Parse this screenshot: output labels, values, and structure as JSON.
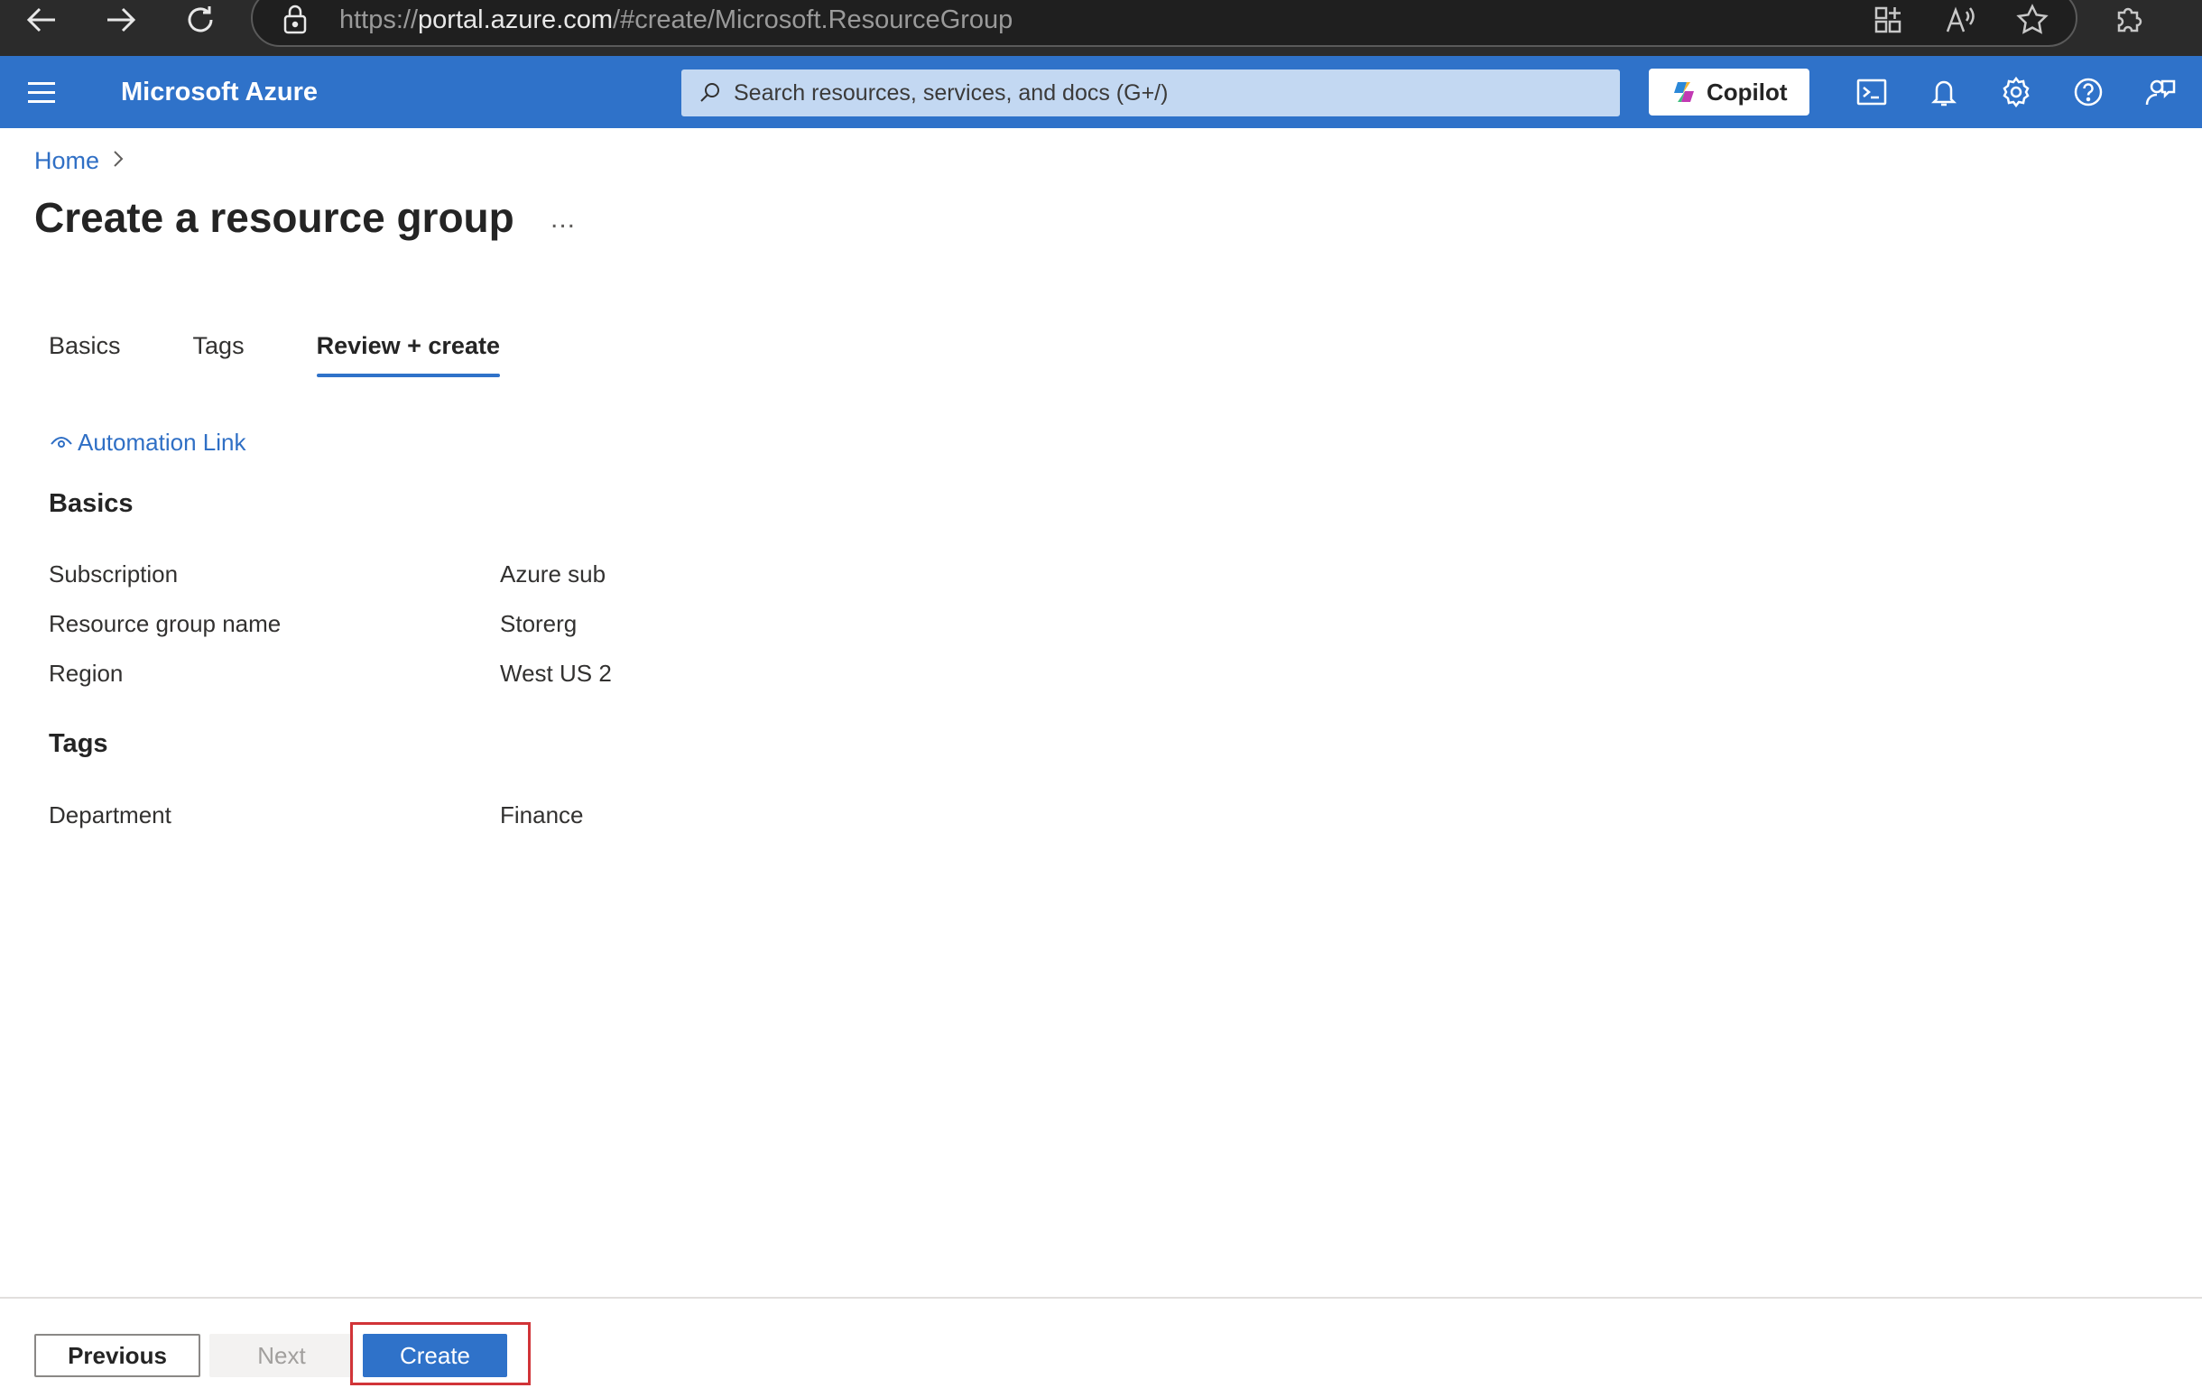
{
  "browser": {
    "url_prefix": "https://",
    "url_host": "portal.azure.com",
    "url_path": "/#create/Microsoft.ResourceGroup"
  },
  "header": {
    "brand": "Microsoft Azure",
    "search_placeholder": "Search resources, services, and docs (G+/)",
    "copilot_label": "Copilot"
  },
  "breadcrumb": {
    "home": "Home"
  },
  "page": {
    "title": "Create a resource group",
    "more": "..."
  },
  "tabs": [
    {
      "label": "Basics"
    },
    {
      "label": "Tags"
    },
    {
      "label": "Review + create"
    }
  ],
  "automation_link": "Automation Link",
  "basics": {
    "heading": "Basics",
    "rows": [
      {
        "label": "Subscription",
        "value": "Azure sub"
      },
      {
        "label": "Resource group name",
        "value": "Storerg"
      },
      {
        "label": "Region",
        "value": "West US 2"
      }
    ]
  },
  "tags": {
    "heading": "Tags",
    "rows": [
      {
        "label": "Department",
        "value": "Finance"
      }
    ]
  },
  "footer": {
    "previous": "Previous",
    "next": "Next",
    "create": "Create"
  },
  "colors": {
    "azure_blue": "#2f72c9",
    "highlight_red": "#d13438"
  }
}
